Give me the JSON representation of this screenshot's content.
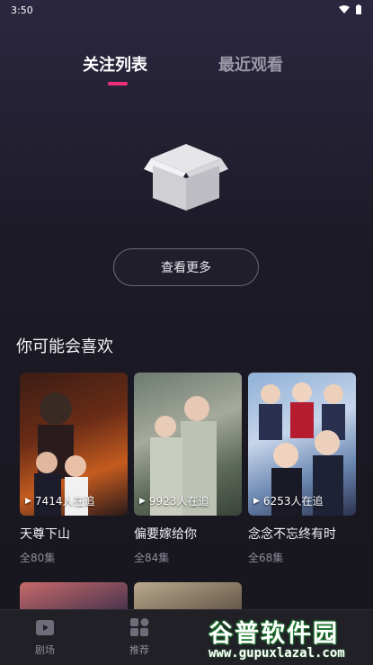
{
  "status_bar": {
    "time": "3:50"
  },
  "tabs": [
    {
      "label": "关注列表",
      "active": true
    },
    {
      "label": "最近观看",
      "active": false
    }
  ],
  "empty_state": {
    "icon": "empty-box-icon",
    "button_label": "查看更多"
  },
  "recommend": {
    "title": "你可能会喜欢",
    "items": [
      {
        "title": "天尊下山",
        "viewers": "7414人在追",
        "episodes": "全80集"
      },
      {
        "title": "偏要嫁给你",
        "viewers": "9923人在追",
        "episodes": "全84集"
      },
      {
        "title": "念念不忘终有时",
        "viewers": "6253人在追",
        "episodes": "全68集"
      }
    ]
  },
  "bottom_nav": [
    {
      "label": "剧场",
      "icon": "clapperboard-icon"
    },
    {
      "label": "推荐",
      "icon": "grid-icon"
    }
  ],
  "watermark": {
    "title": "谷普软件园",
    "url": "www.gupuxlazal.com"
  },
  "colors": {
    "accent": "#f0307a",
    "background": "#1c1a26",
    "nav_bg": "#212027"
  }
}
